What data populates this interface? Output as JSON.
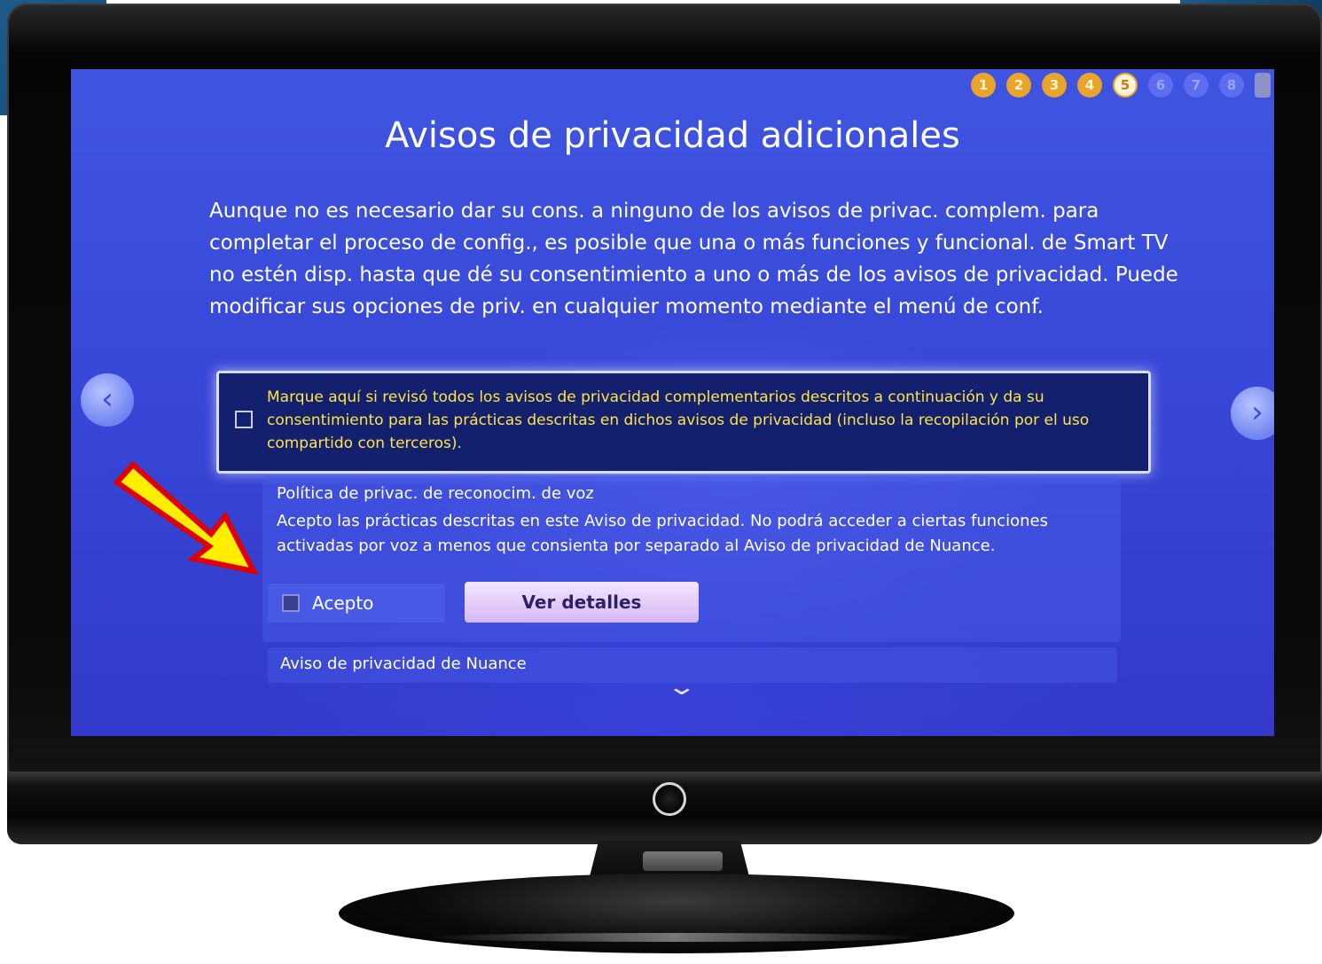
{
  "screen": {
    "title": "Avisos de privacidad adicionales",
    "steps": [
      {
        "label": "1",
        "state": "done"
      },
      {
        "label": "2",
        "state": "done"
      },
      {
        "label": "3",
        "state": "done"
      },
      {
        "label": "4",
        "state": "done"
      },
      {
        "label": "5",
        "state": "current"
      },
      {
        "label": "6",
        "state": "todo"
      },
      {
        "label": "7",
        "state": "todo"
      },
      {
        "label": "8",
        "state": "todo"
      }
    ],
    "intro": "Aunque no es necesario dar su cons. a ninguno de los avisos de privac. complem. para completar el proceso de config., es posible que una o más funciones y funcional. de Smart TV no estén disp. hasta que dé su consentimiento a uno o más de los avisos de privacidad. Puede modificar sus opciones de priv. en cualquier momento mediante el menú de conf.",
    "consent_all": {
      "text": "Marque aquí si revisó todos los avisos de privacidad complementarios descritos a continuación y da su consentimiento para las prácticas descritas en dichos avisos de privacidad (incluso la recopilación por el uso compartido con terceros).",
      "checked": false
    },
    "voice_policy": {
      "title": "Política de privac. de reconocim. de voz",
      "description": "Acepto las prácticas descritas en este Aviso de privacidad. No podrá acceder a ciertas funciones activadas por voz a menos que consienta por separado al Aviso de privacidad de Nuance.",
      "accept_label": "Acepto",
      "accept_checked": false,
      "details_button": "Ver detalles"
    },
    "nuance_policy": {
      "title": "Aviso de privacidad de Nuance"
    },
    "icons": {
      "prev": "chevron-left-icon",
      "next": "chevron-right-icon",
      "scroll": "chevron-down-icon"
    }
  },
  "colors": {
    "screen_blue": "#3848d8",
    "consent_text": "#ffe34a",
    "step_done": "#e9a52b",
    "annotation_arrow": "#ffee00",
    "annotation_border": "#e00000"
  }
}
